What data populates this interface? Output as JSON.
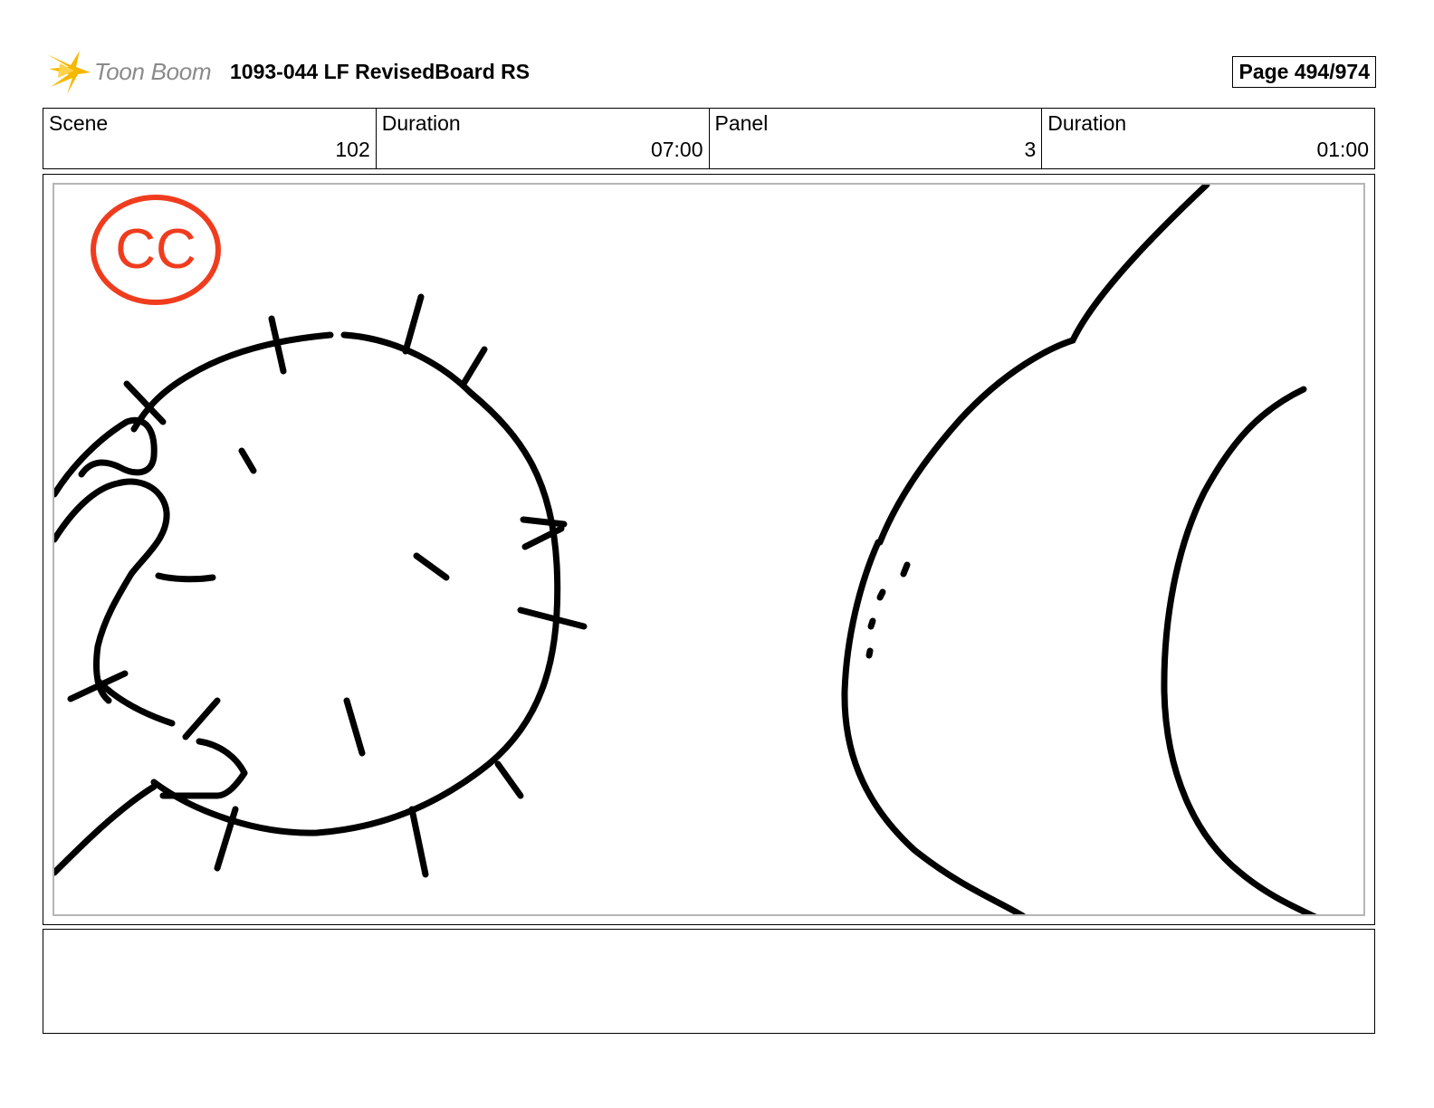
{
  "header": {
    "logo_text": "Toon Boom",
    "document_title": "1093-044 LF RevisedBoard RS",
    "page_label": "Page 494/974"
  },
  "info": {
    "scene_label": "Scene",
    "scene_value": "102",
    "scene_duration_label": "Duration",
    "scene_duration_value": "07:00",
    "panel_label": "Panel",
    "panel_value": "3",
    "panel_duration_label": "Duration",
    "panel_duration_value": "01:00"
  },
  "panel": {
    "stamp_text": "CC",
    "stamp_color": "#f03c1e",
    "line_color": "#000000"
  },
  "notes": {
    "text": ""
  },
  "colors": {
    "logo_star": "#f6b800",
    "logo_text": "#8a8a8a",
    "frame_border": "#b5b5b5"
  }
}
